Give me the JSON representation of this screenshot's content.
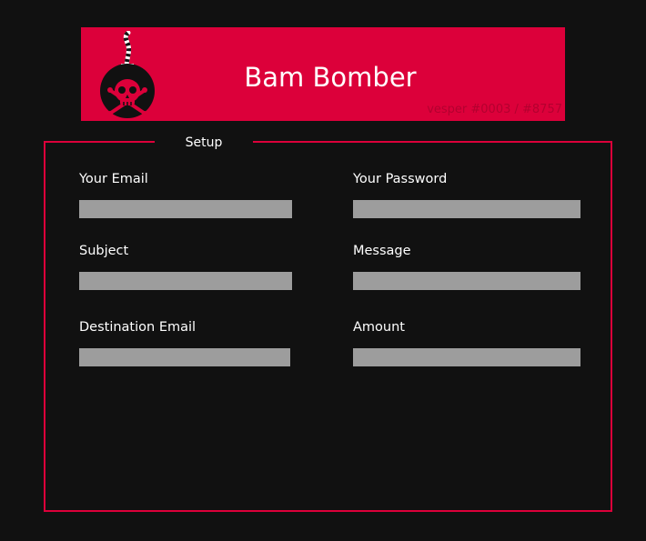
{
  "banner": {
    "title": "Bam Bomber",
    "credit": "vesper #0003 / #8757",
    "logo_icon": "bomb-skull-icon",
    "color": "#dc003a"
  },
  "setup": {
    "legend": "Setup",
    "fields": {
      "your_email": {
        "label": "Your Email",
        "value": "",
        "placeholder": ""
      },
      "your_password": {
        "label": "Your Password",
        "value": "",
        "placeholder": ""
      },
      "subject": {
        "label": "Subject",
        "value": "",
        "placeholder": ""
      },
      "message": {
        "label": "Message",
        "value": "",
        "placeholder": ""
      },
      "destination_email": {
        "label": "Destination Email",
        "value": "",
        "placeholder": ""
      },
      "amount": {
        "label": "Amount",
        "value": "",
        "placeholder": ""
      }
    }
  },
  "colors": {
    "background": "#111111",
    "accent": "#dc003a",
    "input_fill": "#9d9d9d",
    "text": "#ffffff"
  }
}
